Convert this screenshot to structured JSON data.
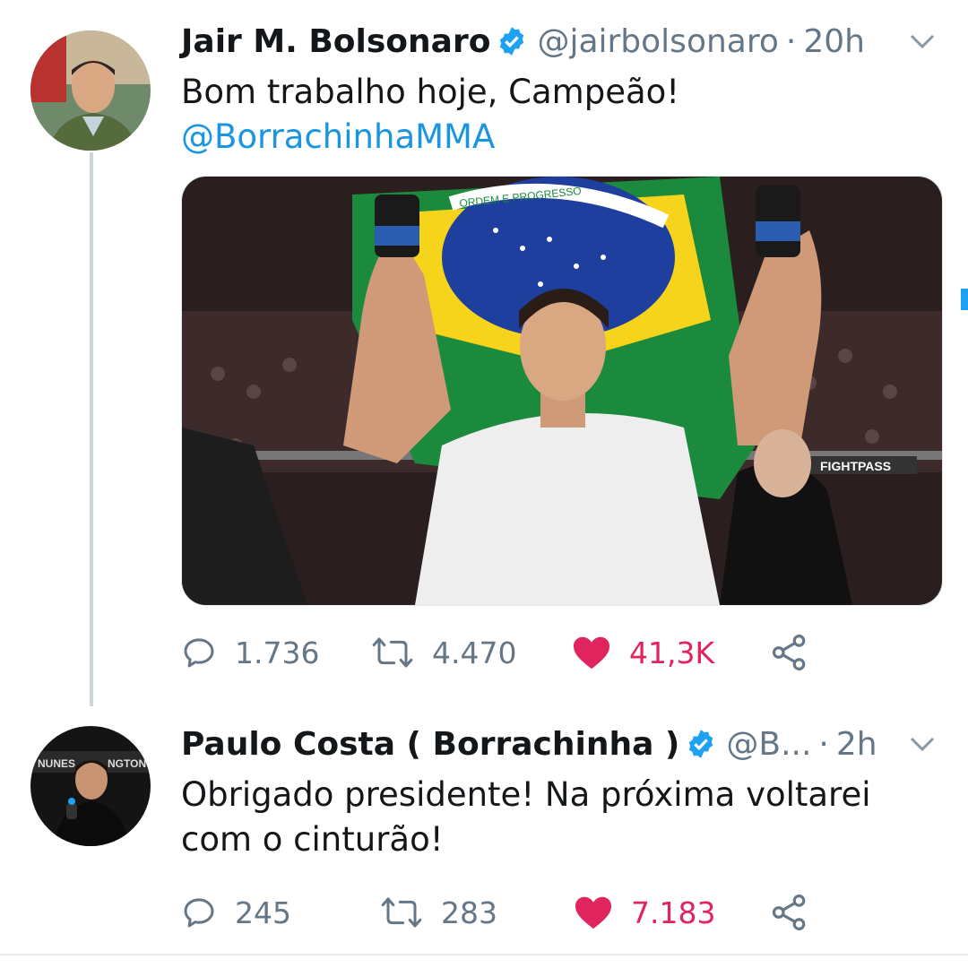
{
  "tweets": [
    {
      "name": "Jair M. Bolsonaro",
      "handle": "@jairbolsonaro",
      "separator": "·",
      "time": "20h",
      "text": "Bom trabalho hoje, Campeão!",
      "mention": "@BorrachinhaMMA",
      "replies": "1.736",
      "retweets": "4.470",
      "likes": "41,3K"
    },
    {
      "name": "Paulo Costa ( Borrachinha )",
      "handle": "@B...",
      "separator": "·",
      "time": "2h",
      "text_line1": "Obrigado presidente! Na próxima voltarei",
      "text_line2": "com o cinturão!",
      "replies": "245",
      "retweets": "283",
      "likes": "7.183"
    }
  ],
  "media": {
    "banner_text": "FIGHTPASS",
    "flag_text": "ORDEM E PROGRESSO"
  },
  "colors": {
    "link": "#1b95e0",
    "like": "#e0245e",
    "muted": "#657786",
    "verified": "#1da1f2"
  },
  "icons": [
    "verified-icon",
    "chevron-down-icon",
    "reply-icon",
    "retweet-icon",
    "heart-icon",
    "share-icon"
  ]
}
